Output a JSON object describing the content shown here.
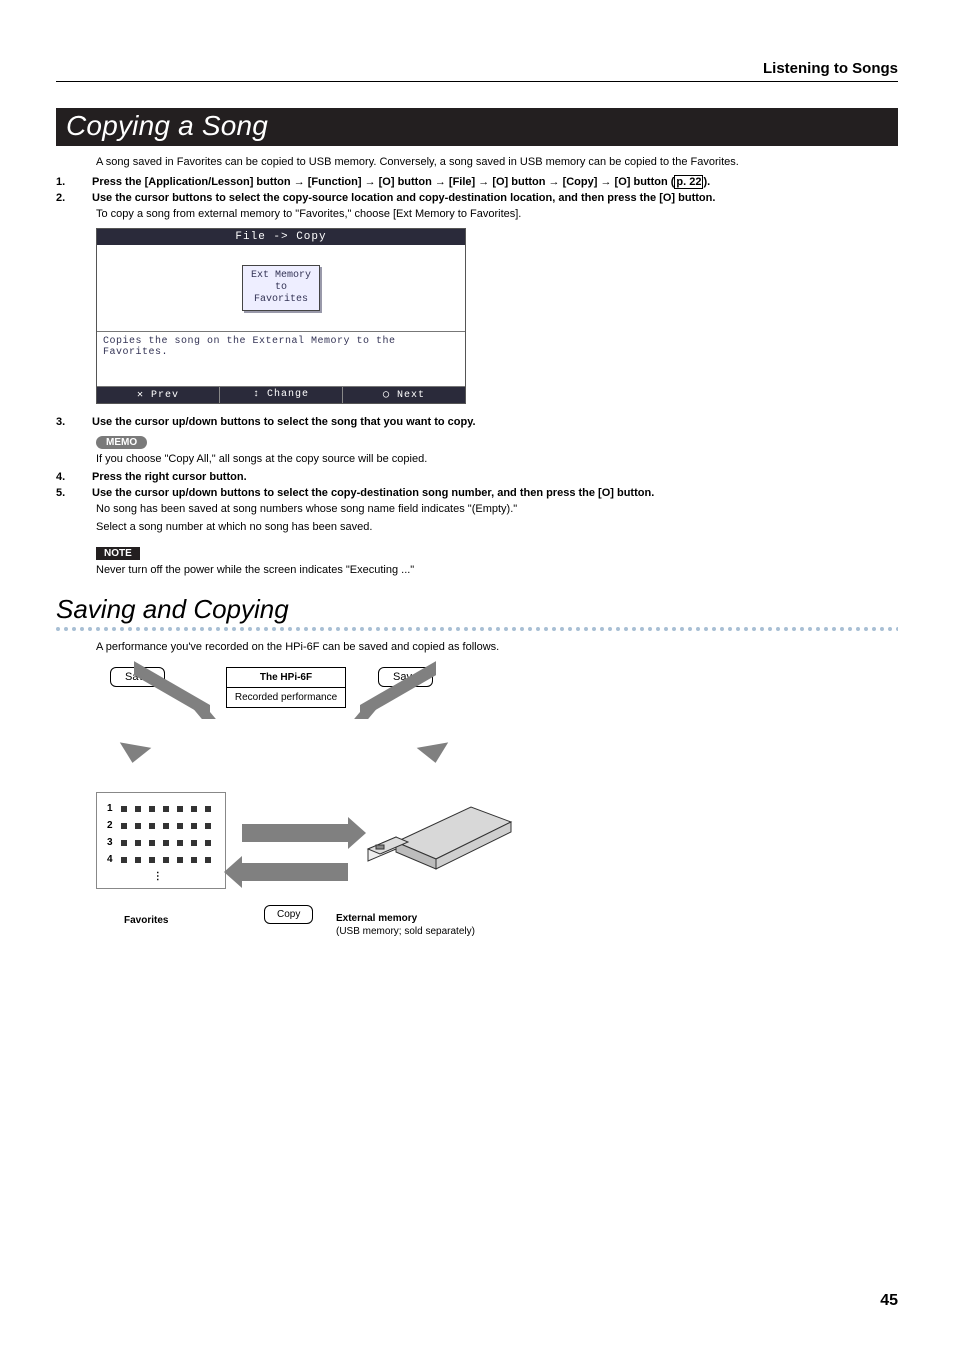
{
  "breadcrumb": "Listening to Songs",
  "h1": "Copying a Song",
  "intro": "A song saved in Favorites can be copied to USB memory. Conversely, a song saved in USB memory can be copied to the Favorites.",
  "steps": {
    "s1_num": "1.",
    "s1_a": "Press the [Application/Lesson] button ",
    "s1_b": " [Function] ",
    "s1_c": " [O] button ",
    "s1_d": " [File] ",
    "s1_e": " [O] button ",
    "s1_f": " [Copy] ",
    "s1_g": " [O] button (",
    "s1_link": "p. 22",
    "s1_end": ").",
    "s2_num": "2.",
    "s2": "Use the cursor buttons to select the copy-source location and copy-destination location, and then press the [O] button.",
    "s2_sub": "To copy a song from external memory to \"Favorites,\" choose [Ext Memory to Favorites].",
    "s3_num": "3.",
    "s3": "Use the cursor up/down buttons to select the song that you want to copy.",
    "s3_sub": "If you choose \"Copy All,\" all songs at the copy source will be copied.",
    "s4_num": "4.",
    "s4": "Press the right cursor button.",
    "s5_num": "5.",
    "s5": "Use the cursor up/down buttons to select the copy-destination song number, and then press the [O] button.",
    "s5_sub1": "No song has been saved at song numbers whose song name field indicates \"(Empty).\"",
    "s5_sub2": "Select a song number at which no song has been saved.",
    "note_sub": "Never turn off the power while the screen indicates \"Executing ...\""
  },
  "memo_label": "MEMO",
  "note_label": "NOTE",
  "screenshot": {
    "title": "File -> Copy",
    "tile_l1": "Ext Memory",
    "tile_l2": "to",
    "tile_l3": "Favorites",
    "desc": "Copies the song on the External Memory to the Favorites.",
    "foot_prev": "✕ Prev",
    "foot_change": "Change",
    "foot_next": "◯ Next"
  },
  "h2": "Saving and Copying",
  "h2_sub": "A performance you've recorded on the HPi-6F can be saved and copied as follows.",
  "diagram": {
    "save": "Save",
    "perf_title": "The HPi-6F",
    "perf_body": "Recorded performance",
    "fav_nums": [
      "1",
      "2",
      "3",
      "4"
    ],
    "fav_label": "Favorites",
    "copy": "Copy",
    "ext_l1": "External memory",
    "ext_l2": "(USB memory; sold separately)"
  },
  "pagenum": "45"
}
